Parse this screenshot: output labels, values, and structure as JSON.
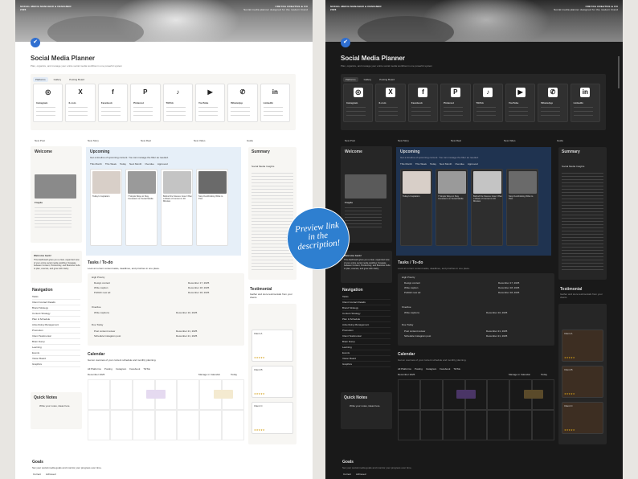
{
  "banner": {
    "left_line1": "SOCIAL MEDIA MANAGER & DESIGNER",
    "left_line2": "2026",
    "right_line1": "FREYDA CREATIVE & CO",
    "right_line2": "Social media planner designed for the modern brand"
  },
  "page": {
    "title": "Social Media Planner",
    "subtitle": "Plan, organize, and manage your entire social media workflow in one powerful system"
  },
  "platform_tabs": [
    "Platforms",
    "Gallery",
    "Posting Board"
  ],
  "socials": [
    {
      "name": "Instagram",
      "icon": "instagram-icon",
      "glyph": "◎"
    },
    {
      "name": "X.com",
      "icon": "x-icon",
      "glyph": "X"
    },
    {
      "name": "Facebook",
      "icon": "facebook-icon",
      "glyph": "f"
    },
    {
      "name": "Pinterest",
      "icon": "pinterest-icon",
      "glyph": "P"
    },
    {
      "name": "TikTok",
      "icon": "tiktok-icon",
      "glyph": "♪"
    },
    {
      "name": "YouTube",
      "icon": "youtube-icon",
      "glyph": "▶"
    },
    {
      "name": "WhatsApp",
      "icon": "whatsapp-icon",
      "glyph": "✆"
    },
    {
      "name": "LinkedIn",
      "icon": "linkedin-icon",
      "glyph": "in"
    }
  ],
  "new_buttons": [
    "New Post",
    "New Story",
    "New Reel",
    "New Video",
    "Guide"
  ],
  "welcome": {
    "heading": "Welcome",
    "profile_name": "Frayda",
    "greeting_heading": "Welcome back!",
    "greeting_text": "This dashboard gives you a clear, organized view of your entire social media workflow. Navigate between Content, Productivity, and Business hubs to plan, execute, and grow with clarity."
  },
  "upcoming": {
    "heading": "Upcoming",
    "subtitle": "Get a timeline of upcoming content. You can manage the filter as needed.",
    "tabs": [
      "This Month",
      "This Week",
      "Today",
      "Next Month",
      "Overdue",
      "Approved"
    ],
    "cards": [
      {
        "title": "Today's Inspiration",
        "tag": "Idea"
      },
      {
        "title": "7 Simple Ways to Stay Consistent on Social Media",
        "tag": "Draft"
      },
      {
        "title": "Behind the Scenes: How I Plan a Week of Content in 30 Minutes",
        "tag": "Draft"
      },
      {
        "title": "Stop Overthinking What to Post",
        "tag": "Draft"
      },
      {
        "title": "Minimal Social Media Planning System",
        "tag": "Draft"
      }
    ]
  },
  "summary": {
    "heading": "Summary",
    "subtitle": "Get insights and overviews of your content and tasks",
    "insights_label": "Social Media Insights",
    "items": [
      "Today's Insights",
      "This Week's Content",
      "The Month's Content",
      "Planned Content",
      "Draft Content",
      "Ready to Post",
      "Published Content",
      "Overdue",
      "Upcoming",
      "To-do"
    ]
  },
  "tasks": {
    "heading": "Tasks / To-do",
    "subtitle": "Look at current content tasks, deadlines, and priorities in one place.",
    "groups": [
      {
        "label": "High Priority",
        "items": [
          {
            "name": "Design content",
            "date": "December 17, 2025",
            "status": "High Priority"
          },
          {
            "name": "Write caption",
            "date": "December 18, 2025",
            "status": "High Priority"
          },
          {
            "name": "Publish new ad",
            "date": "December 18, 2025",
            "status": "High Priority"
          }
        ]
      },
      {
        "label": "Overdue",
        "items": [
          {
            "name": "Write captions",
            "date": "December 10, 2025",
            "status": "High Priority"
          }
        ]
      },
      {
        "label": "Due Today",
        "items": [
          {
            "name": "Post content review",
            "date": "December 21, 2025",
            "status": "Completed"
          },
          {
            "name": "Schedule Instagram post",
            "date": "December 21, 2025",
            "status": "Completed"
          }
        ]
      }
    ]
  },
  "testimonial": {
    "heading": "Testimonial",
    "subtitle": "Gather and store testimonials from your clients",
    "label": "Gallery view",
    "entries": [
      {
        "name": "Client A",
        "stars": "★★★★★"
      },
      {
        "name": "Client B",
        "stars": "★★★★★"
      },
      {
        "name": "Client C",
        "stars": "★★★★★"
      }
    ]
  },
  "navigation": {
    "heading": "Navigation",
    "items": [
      "Tasks",
      "Client Contact Details",
      "Brand Strategy",
      "Content Strategy",
      "Plan & Schedule",
      "Advertising Management",
      "Promotion",
      "Client Testimonial",
      "Brain Dump",
      "Learning",
      "Events",
      "Vision Board",
      "Graphics"
    ]
  },
  "calendar": {
    "heading": "Calendar",
    "subtitle": "Get an overview of your content schedule and monthly planning.",
    "month": "December 2025",
    "tabs": [
      "All Platforms",
      "Posting",
      "Instagram",
      "Facebook",
      "TikTok",
      "Pinterest",
      "YouTube",
      "Threads",
      "LinkedIn",
      "Pinterest"
    ],
    "manage_label": "Manage in Calendar",
    "today_label": "Today",
    "weekdays": [
      "Sun",
      "Mon",
      "Tue",
      "Wed",
      "Thu",
      "Fri",
      "Sat"
    ]
  },
  "quick_notes": {
    "heading": "Quick Notes",
    "text": "Write your notes, ideas here."
  },
  "goals": {
    "heading": "Goals",
    "subtitle": "Set your social media goals and monitor your progress over time.",
    "tabs": [
      "Current",
      "Achieved"
    ]
  },
  "stamp_text": [
    "Preview link",
    "in the",
    "description!"
  ],
  "colors": {
    "accent_blue": "#2e7fd0",
    "dark_bg": "#191919",
    "light_bg": "#ffffff",
    "upcoming_light": "#e6eff8",
    "upcoming_dark": "#1f3350"
  }
}
